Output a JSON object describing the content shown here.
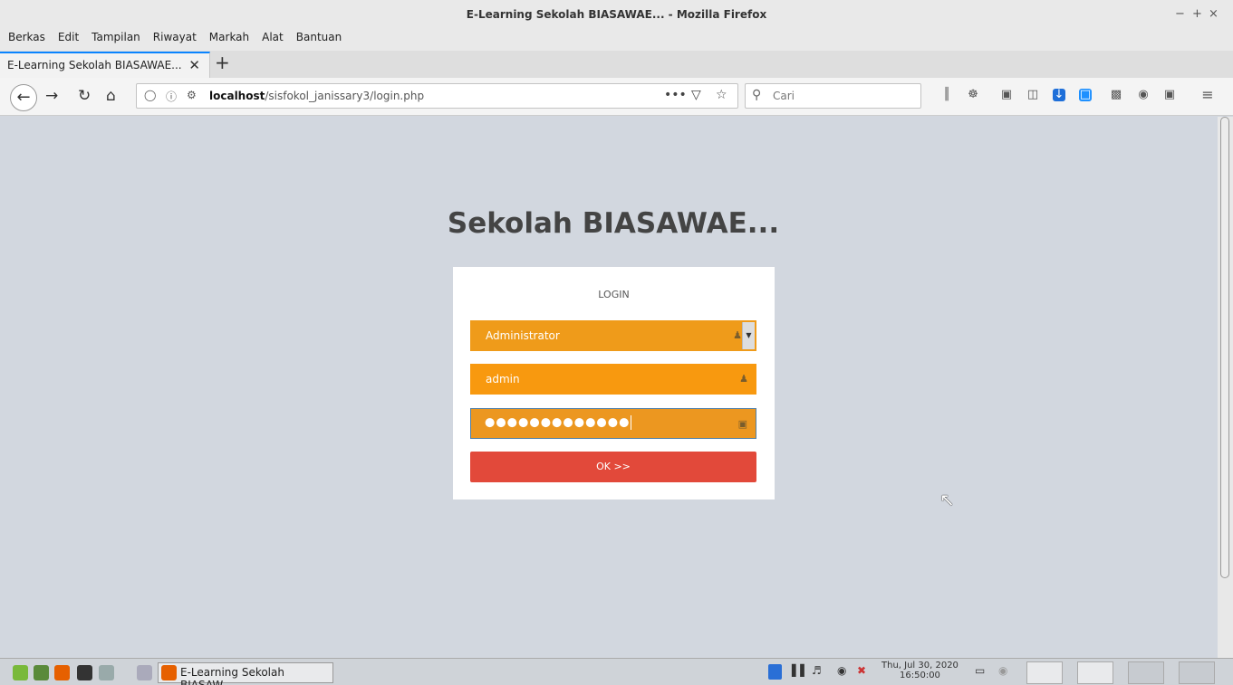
{
  "window": {
    "title": "E-Learning Sekolah BIASAWAE... - Mozilla Firefox",
    "controls": [
      "−",
      "+",
      "×"
    ]
  },
  "menubar": {
    "items": [
      "Berkas",
      "Edit",
      "Tampilan",
      "Riwayat",
      "Markah",
      "Alat",
      "Bantuan"
    ]
  },
  "tabs": {
    "active_tab_title": "E-Learning Sekolah BIASAWAE...",
    "close_glyph": "✕",
    "new_tab_glyph": "+"
  },
  "navbar": {
    "url_host": "localhost",
    "url_path": "/sisfokol_janissary3/login.php",
    "search_placeholder": "Cari",
    "page_actions_glyph": "•••"
  },
  "page": {
    "title": "Sekolah BIASAWAE...",
    "login_heading": "LOGIN",
    "role_select_value": "Administrator",
    "username_value": "admin",
    "password_masked": "●●●●●●●●●●●●●",
    "ok_label": "OK >>"
  },
  "taskbar": {
    "window_label": "E-Learning Sekolah BIASAW...",
    "clock_date": "Thu, Jul 30, 2020",
    "clock_time": "16:50:00"
  },
  "colors": {
    "page_background": "#d2d7df",
    "field_orange": "#f8990f",
    "ok_button": "#e2493a",
    "tab_accent": "#0a84ff"
  }
}
